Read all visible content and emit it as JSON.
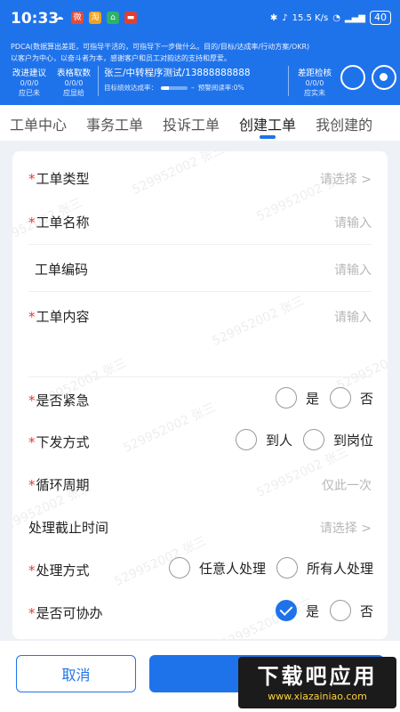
{
  "status": {
    "time": "10:33",
    "net_speed": "15.5 K/s",
    "battery": "40"
  },
  "header": {
    "pdca_text": "PDCA(数据算出差距，可指导干活的，可指导下一步做什么。目的/目标/达成率/行动方案/OKR)",
    "slogan": "以客户为中心，以奋斗者为本，感谢客户和员工对韵达的支持和厚爱。",
    "metrics": [
      {
        "label": "改进建议",
        "value": "0/0/0",
        "sub": "应已未"
      },
      {
        "label": "表格取数",
        "value": "0/0/0",
        "sub": "应显给"
      }
    ],
    "user": "张三/中转程序测试/13888888888",
    "kpi_label": "目标绩效达成率：",
    "kpi_value": "–",
    "kpi_fill": 0.3,
    "warn_label": "预警阅读率:0%",
    "right_metric": {
      "label": "差距检核",
      "value": "0/0/0",
      "sub": "应实未"
    },
    "icons": [
      "search-icon",
      "target-icon"
    ]
  },
  "tabs": [
    "工单中心",
    "事务工单",
    "投诉工单",
    "创建工单",
    "我创建的"
  ],
  "active_tab": 3,
  "form": {
    "type": {
      "label": "工单类型",
      "placeholder": "请选择 >"
    },
    "name": {
      "label": "工单名称",
      "placeholder": "请输入"
    },
    "code": {
      "label": "工单编码",
      "placeholder": "请输入"
    },
    "content": {
      "label": "工单内容",
      "placeholder": "请输入"
    },
    "urgent": {
      "label": "是否紧急",
      "options": [
        "是",
        "否"
      ]
    },
    "dispatch": {
      "label": "下发方式",
      "options": [
        "到人",
        "到岗位"
      ]
    },
    "cycle": {
      "label": "循环周期",
      "value": "仅此一次"
    },
    "deadline": {
      "label": "处理截止时间",
      "placeholder": "请选择 >"
    },
    "handling": {
      "label": "处理方式",
      "options": [
        "任意人处理",
        "所有人处理"
      ]
    },
    "assist": {
      "label": "是否可协办",
      "options": [
        "是",
        "否"
      ],
      "selected": 0
    }
  },
  "watermark": "529952002 张三",
  "footer": {
    "cancel": "取消",
    "logo_title": "下载吧应用",
    "logo_url": "www.xiazainiao.com"
  },
  "colors": {
    "primary": "#1f73ea",
    "required": "#e33a2e"
  }
}
